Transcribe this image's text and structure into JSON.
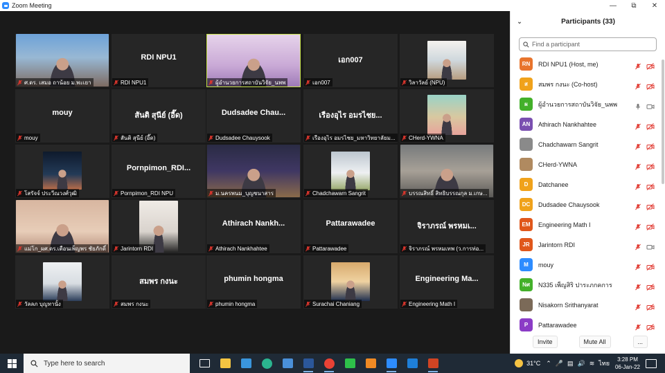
{
  "window": {
    "title": "Zoom Meeting",
    "controls": [
      "minimize-icon",
      "restore-icon",
      "close-icon"
    ]
  },
  "tiles": [
    {
      "label": "ศ.ดร. เสมอ ถาน้อย ม.พะเยา",
      "center": "",
      "video": true,
      "highlight": false
    },
    {
      "label": "RDI NPU1",
      "center": "RDI NPU1",
      "video": false,
      "highlight": false
    },
    {
      "label": "ผู้อำนวยการสถาบันวิจัย_นพพ",
      "center": "",
      "video": true,
      "highlight": true
    },
    {
      "label": "เอก007",
      "center": "เอก007",
      "video": false,
      "highlight": false
    },
    {
      "label": "วิลาวัลย์ (NPU)",
      "center": "",
      "video": true,
      "highlight": false
    },
    {
      "label": "mouy",
      "center": "mouy",
      "video": false,
      "highlight": false
    },
    {
      "label": "สันติ สุนีย์ (อี๊ด)",
      "center": "สันติ สุนีย์ (อี๊ด)",
      "video": false,
      "highlight": false
    },
    {
      "label": "Dudsadee Chauysook",
      "center": "Dudsadee Chau...",
      "video": false,
      "highlight": false
    },
    {
      "label": "เรืองอุไร อมรไชย_มหาวิทยาลัยม...",
      "center": "เรืองอุไร อมรไชย...",
      "video": false,
      "highlight": false
    },
    {
      "label": "CHerd-YWNA",
      "center": "",
      "video": true,
      "highlight": false
    },
    {
      "label": "โสรัจจ์ ประวีณวงศ์วุฒิ",
      "center": "",
      "video": true,
      "highlight": false
    },
    {
      "label": "Pornpimon_RDI NPU",
      "center": "Pornpimon_RDI...",
      "video": false,
      "highlight": false
    },
    {
      "label": "ม.นครพนม_บุญชนาสาร",
      "center": "",
      "video": true,
      "highlight": false
    },
    {
      "label": "Chadchawarn Sangrit",
      "center": "",
      "video": true,
      "highlight": false
    },
    {
      "label": "บรรณสิทธิ์ สิทธิบรรณกุล ม.เกษ...",
      "center": "",
      "video": true,
      "highlight": false
    },
    {
      "label": "แม่โก_ผศ.ดร.เดือนเพ็ญพร ชัยภักดิ์",
      "center": "",
      "video": true,
      "highlight": false
    },
    {
      "label": "Jarintorn RDI",
      "center": "",
      "video": true,
      "highlight": false
    },
    {
      "label": "Athirach Nankhahtee",
      "center": "Athirach Nankh...",
      "video": false,
      "highlight": false
    },
    {
      "label": "Pattarawadee",
      "center": "Pattarawadee",
      "video": false,
      "highlight": false
    },
    {
      "label": "จิราภรณ์ พรหมเทพ (ว.การท่อ...",
      "center": "จิราภรณ์ พรหมเ...",
      "video": false,
      "highlight": false
    },
    {
      "label": "วัลลภ บุญทานั้ง",
      "center": "",
      "video": true,
      "highlight": false
    },
    {
      "label": "สมพร กงนะ",
      "center": "สมพร กงนะ",
      "video": false,
      "highlight": false
    },
    {
      "label": "phumin hongma",
      "center": "phumin hongma",
      "video": false,
      "highlight": false
    },
    {
      "label": "Surachai Chaniang",
      "center": "",
      "video": true,
      "highlight": false
    },
    {
      "label": "Engineering Math I",
      "center": "Engineering Ma...",
      "video": false,
      "highlight": false
    }
  ],
  "panel": {
    "title": "Participants (33)",
    "search_placeholder": "Find a participant",
    "participants": [
      {
        "initials": "RN",
        "color": "#e8742c",
        "name": "RDI NPU1 (Host, me)",
        "mic": "muted",
        "cam": "off"
      },
      {
        "initials": "ส",
        "color": "#f0a21b",
        "name": "สมพร กงนะ (Co-host)",
        "mic": "muted",
        "cam": "off"
      },
      {
        "initials": "ผ",
        "color": "#43b02a",
        "name": "ผู้อำนวยการสถาบันวิจัย_นพพ",
        "mic": "on",
        "cam": "on"
      },
      {
        "initials": "AN",
        "color": "#7a4fb0",
        "name": "Athirach Nankhahtee",
        "mic": "muted",
        "cam": "off"
      },
      {
        "initials": "",
        "color": "#8a8a8a",
        "name": "Chadchawarn Sangrit",
        "mic": "muted",
        "cam": "off"
      },
      {
        "initials": "",
        "color": "#b08a60",
        "name": "CHerd-YWNA",
        "mic": "muted",
        "cam": "off"
      },
      {
        "initials": "D",
        "color": "#f0a21b",
        "name": "Datchanee",
        "mic": "muted",
        "cam": "off"
      },
      {
        "initials": "DC",
        "color": "#f0a21b",
        "name": "Dudsadee Chauysook",
        "mic": "muted",
        "cam": "off"
      },
      {
        "initials": "EM",
        "color": "#e0571b",
        "name": "Engineering Math I",
        "mic": "muted",
        "cam": "off"
      },
      {
        "initials": "JR",
        "color": "#e0571b",
        "name": "Jarintorn RDI",
        "mic": "muted",
        "cam": "on"
      },
      {
        "initials": "M",
        "color": "#2d8cff",
        "name": "mouy",
        "mic": "muted",
        "cam": "off"
      },
      {
        "initials": "Nศ",
        "color": "#43b02a",
        "name": "N335 เพ็ญสิริ ปาระภกคการ",
        "mic": "muted",
        "cam": "off"
      },
      {
        "initials": "",
        "color": "#7b6a58",
        "name": "Nisakorn Srithanyarat",
        "mic": "muted",
        "cam": "off"
      },
      {
        "initials": "P",
        "color": "#8b3cc6",
        "name": "Pattarawadee",
        "mic": "muted",
        "cam": "off"
      }
    ],
    "invite": "Invite",
    "mute_all": "Mute All",
    "more": "..."
  },
  "taskbar": {
    "search_placeholder": "Type here to search",
    "temperature": "31°C",
    "language": "ไทย",
    "time": "3:28 PM",
    "date": "06-Jan-22",
    "apps": [
      "task-view-icon",
      "file-explorer-icon",
      "store-icon",
      "edge-icon",
      "mail-icon",
      "word-icon",
      "chrome-icon",
      "line-icon",
      "app-orange-icon",
      "zoom-icon",
      "photos-icon",
      "powerpoint-icon"
    ]
  },
  "colors": {
    "accent": "#2d8cff",
    "muted": "#e0362d",
    "active_speaker": "#c7e349",
    "tile_bg": "#262626"
  }
}
